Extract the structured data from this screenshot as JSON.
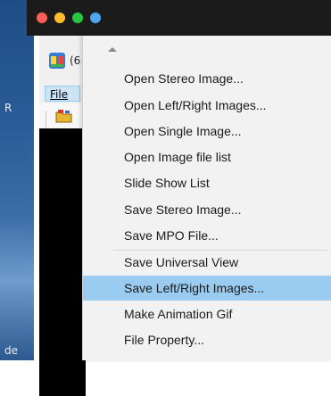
{
  "desktop": {
    "label_top": "R",
    "label_bottom": "de"
  },
  "window": {
    "title_fragment": "(6"
  },
  "menubar": {
    "file_label": "File"
  },
  "colors": {
    "highlight": "#99ccf0",
    "menu_bg": "#f2f2f2",
    "titlebar": "#1b1b1b"
  },
  "dropdown": {
    "items": [
      {
        "label": "Open Stereo Image..."
      },
      {
        "label": "Open Left/Right Images..."
      },
      {
        "label": "Open Single Image..."
      },
      {
        "label": "Open Image file list"
      },
      {
        "label": "Slide Show List"
      },
      {
        "label": "Save Stereo Image..."
      },
      {
        "label": "Save MPO File..."
      },
      {
        "label": "Save Universal View"
      },
      {
        "label": "Save Left/Right Images..."
      },
      {
        "label": "Make Animation Gif"
      },
      {
        "label": "File Property..."
      }
    ],
    "highlighted_item": "Save Left/Right Images..."
  }
}
